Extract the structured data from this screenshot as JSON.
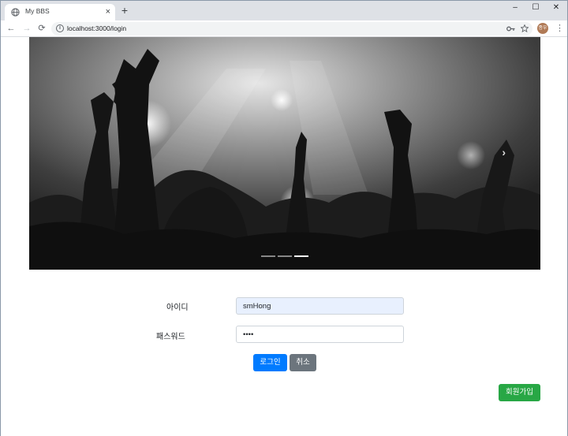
{
  "browser": {
    "tab_title": "My BBS",
    "tab_close": "×",
    "new_tab": "+",
    "url": "localhost:3000/login",
    "avatar_initials": "종우",
    "window_controls": {
      "minimize": "–",
      "maximize": "☐",
      "close": "✕"
    },
    "nav": {
      "back": "←",
      "forward": "→",
      "reload": "⟳"
    },
    "icons": [
      "globe-icon",
      "key-icon",
      "star-icon",
      "kebab-menu-icon",
      "info-icon"
    ]
  },
  "carousel": {
    "slide_count": 3,
    "active_index": 2,
    "next_glyph": "›"
  },
  "login_form": {
    "id_label": "아이디",
    "id_value": "smHong",
    "password_label": "패스워드",
    "password_value": "••••",
    "login_button": "로그인",
    "cancel_button": "취소"
  },
  "signup_button": "회원가입",
  "colors": {
    "primary": "#007bff",
    "secondary": "#6c757d",
    "success": "#28a745",
    "autofill_bg": "#e8f0fe"
  }
}
